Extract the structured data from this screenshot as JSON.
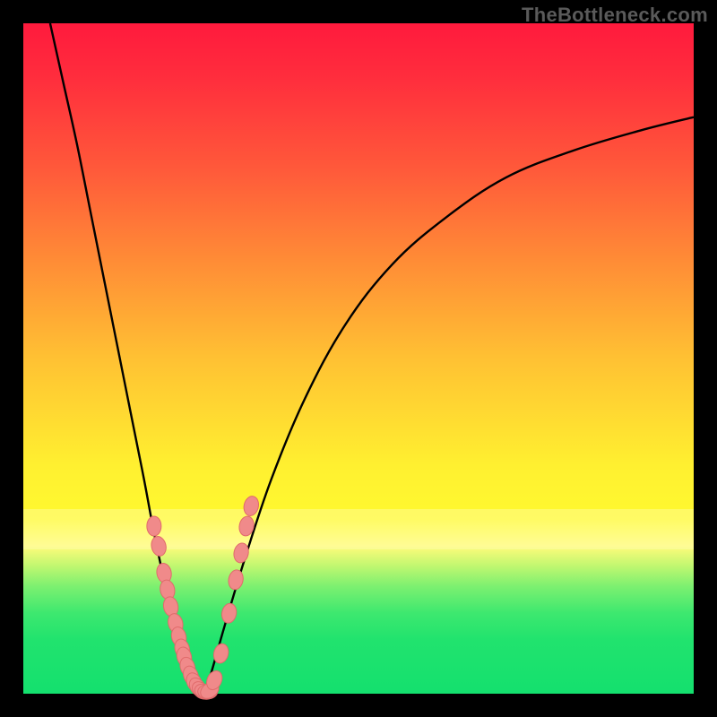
{
  "brand": "TheBottleneck.com",
  "colors": {
    "curve": "#000000",
    "marker_fill": "#f08a8a",
    "marker_stroke": "#e06b6b"
  },
  "chart_data": {
    "type": "line",
    "title": "",
    "xlabel": "",
    "ylabel": "",
    "xlim": [
      0,
      100
    ],
    "ylim": [
      0,
      100
    ],
    "note": "No axis ticks or numeric labels are rendered in the image; x/y values below are normalized 0–100 estimates read from curve geometry.",
    "series": [
      {
        "name": "left-curve",
        "x": [
          4,
          6,
          8,
          10,
          12,
          14,
          16,
          18,
          19.5,
          21,
          22.5,
          24,
          25,
          26,
          27
        ],
        "y": [
          100,
          91,
          82,
          72,
          62,
          52,
          42,
          32,
          24,
          17,
          11,
          6,
          3,
          1,
          0
        ]
      },
      {
        "name": "right-curve",
        "x": [
          27,
          28,
          30,
          33,
          37,
          42,
          48,
          55,
          63,
          72,
          82,
          92,
          100
        ],
        "y": [
          0,
          3,
          10,
          20,
          32,
          44,
          55,
          64,
          71,
          77,
          81,
          84,
          86
        ]
      }
    ],
    "markers": {
      "name": "highlighted-points",
      "description": "Pink bead-like markers clustered near the valley on both curve arms",
      "points_xy": [
        [
          19.5,
          25
        ],
        [
          20.2,
          22
        ],
        [
          21,
          18
        ],
        [
          21.5,
          15.5
        ],
        [
          22,
          13
        ],
        [
          22.7,
          10.5
        ],
        [
          23.2,
          8.5
        ],
        [
          23.7,
          6.7
        ],
        [
          24,
          5.5
        ],
        [
          24.5,
          4
        ],
        [
          25,
          2.7
        ],
        [
          25.5,
          1.7
        ],
        [
          26,
          1
        ],
        [
          26.5,
          0.5
        ],
        [
          27,
          0.3
        ],
        [
          27.5,
          0.3
        ],
        [
          27.8,
          0.5
        ],
        [
          28.5,
          2
        ],
        [
          29.5,
          6
        ],
        [
          30.7,
          12
        ],
        [
          31.7,
          17
        ],
        [
          32.5,
          21
        ],
        [
          33.3,
          25
        ],
        [
          34,
          28
        ]
      ]
    }
  }
}
